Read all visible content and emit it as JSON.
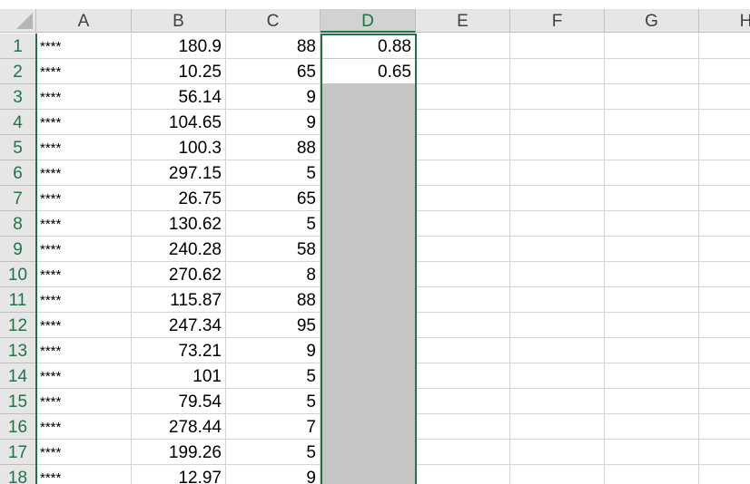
{
  "spreadsheet": {
    "columns": [
      "A",
      "B",
      "C",
      "D",
      "E",
      "F",
      "G",
      "H"
    ],
    "selected_column": "D",
    "rows": [
      {
        "n": "1",
        "a": "****",
        "b": "180.9",
        "c": "88",
        "d": "0.88"
      },
      {
        "n": "2",
        "a": "****",
        "b": "10.25",
        "c": "65",
        "d": "0.65"
      },
      {
        "n": "3",
        "a": "****",
        "b": "56.14",
        "c": "9",
        "d": ""
      },
      {
        "n": "4",
        "a": "****",
        "b": "104.65",
        "c": "9",
        "d": ""
      },
      {
        "n": "5",
        "a": "****",
        "b": "100.3",
        "c": "88",
        "d": ""
      },
      {
        "n": "6",
        "a": "****",
        "b": "297.15",
        "c": "5",
        "d": ""
      },
      {
        "n": "7",
        "a": "****",
        "b": "26.75",
        "c": "65",
        "d": ""
      },
      {
        "n": "8",
        "a": "****",
        "b": "130.62",
        "c": "5",
        "d": ""
      },
      {
        "n": "9",
        "a": "****",
        "b": "240.28",
        "c": "58",
        "d": ""
      },
      {
        "n": "10",
        "a": "****",
        "b": "270.62",
        "c": "8",
        "d": ""
      },
      {
        "n": "11",
        "a": "****",
        "b": "115.87",
        "c": "88",
        "d": ""
      },
      {
        "n": "12",
        "a": "****",
        "b": "247.34",
        "c": "95",
        "d": ""
      },
      {
        "n": "13",
        "a": "****",
        "b": "73.21",
        "c": "9",
        "d": ""
      },
      {
        "n": "14",
        "a": "****",
        "b": "101",
        "c": "5",
        "d": ""
      },
      {
        "n": "15",
        "a": "****",
        "b": "79.54",
        "c": "5",
        "d": ""
      },
      {
        "n": "16",
        "a": "****",
        "b": "278.44",
        "c": "7",
        "d": ""
      },
      {
        "n": "17",
        "a": "****",
        "b": "199.26",
        "c": "5",
        "d": ""
      },
      {
        "n": "18",
        "a": "****",
        "b": "12.97",
        "c": "9",
        "d": ""
      }
    ]
  },
  "colors": {
    "selection_accent": "#217346",
    "header_bg": "#e6e6e6",
    "selected_fill": "#c6c6c6",
    "gridline": "#d4d4d4"
  }
}
